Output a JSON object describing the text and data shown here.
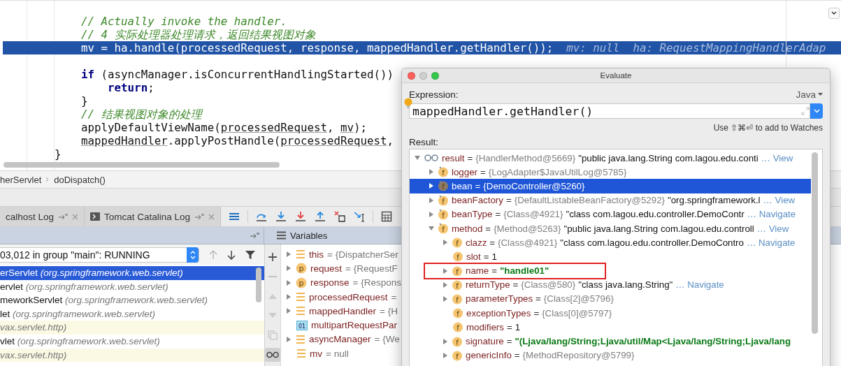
{
  "editor": {
    "lines": [
      {
        "kind": "body",
        "selected": false,
        "tokens": [
          {
            "text": "// Actually invoke the handler.",
            "kind": "comment"
          }
        ]
      },
      {
        "kind": "body",
        "selected": false,
        "tokens": [
          {
            "text": "// 4 实际处理器处理请求，返回结果视图对象",
            "kind": "comment"
          }
        ]
      },
      {
        "kind": "body",
        "selected": true,
        "tokens": [
          {
            "text": "mv = ha.handle(processedRequest, response, mappedHandler.getHandler());",
            "kind": "plain"
          }
        ],
        "hint": "mv: null  ha: RequestMappingHandlerAdap"
      },
      {
        "kind": "blank",
        "selected": false
      },
      {
        "kind": "body",
        "selected": false,
        "tokens": [
          {
            "text": "if",
            "kind": "keyword"
          },
          {
            "text": " (asyncManager.isConcurrentHandlingStarted())",
            "kind": "plain"
          }
        ]
      },
      {
        "kind": "inner",
        "selected": false,
        "tokens": [
          {
            "text": "return",
            "kind": "keyword"
          },
          {
            "text": ";",
            "kind": "plain"
          }
        ]
      },
      {
        "kind": "body",
        "selected": false,
        "tokens": [
          {
            "text": "}",
            "kind": "plain"
          }
        ]
      },
      {
        "kind": "body",
        "selected": false,
        "tokens": [
          {
            "text": "// 结果视图对象的处理",
            "kind": "comment"
          }
        ]
      },
      {
        "kind": "body",
        "selected": false,
        "tokens": [
          {
            "text": "applyDefaultViewName(",
            "kind": "plain"
          },
          {
            "text": "processedRequest",
            "kind": "underlined"
          },
          {
            "text": ", ",
            "kind": "plain"
          },
          {
            "text": "mv",
            "kind": "underlined"
          },
          {
            "text": ");",
            "kind": "plain"
          }
        ]
      },
      {
        "kind": "body",
        "selected": false,
        "tokens": [
          {
            "text": "mappedHandler",
            "kind": "underlined"
          },
          {
            "text": ".applyPostHandle(",
            "kind": "plain"
          },
          {
            "text": "processedRequest",
            "kind": "underlined"
          },
          {
            "text": ",",
            "kind": "plain"
          }
        ]
      },
      {
        "kind": "close",
        "selected": false,
        "tokens": [
          {
            "text": "}",
            "kind": "plain"
          }
        ]
      }
    ]
  },
  "breadcrumb": [
    "herServlet",
    "doDispatch()"
  ],
  "debug_tabs": [
    {
      "label": "calhost Log",
      "selected": false
    },
    {
      "label": "Tomcat Catalina Log",
      "selected": false
    }
  ],
  "frames": {
    "thread": "03,012 in group \"main\": RUNNING",
    "items": [
      {
        "method": "erServlet",
        "package": "(org.springframework.web.servlet)",
        "selected": true,
        "library": false
      },
      {
        "method": "ervlet",
        "package": "(org.springframework.web.servlet)",
        "selected": false,
        "library": false
      },
      {
        "method": "meworkServlet",
        "package": "(org.springframework.web.servlet)",
        "selected": false,
        "library": false
      },
      {
        "method": "let",
        "package": "(org.springframework.web.servlet)",
        "selected": false,
        "library": false
      },
      {
        "package": "vax.servlet.http)",
        "selected": false,
        "library": true
      },
      {
        "method": "vlet",
        "package": "(org.springframework.web.servlet)",
        "selected": false,
        "library": false
      },
      {
        "package": "vax.servlet.http)",
        "selected": false,
        "library": true
      }
    ]
  },
  "variables": {
    "title": "Variables",
    "items": [
      {
        "kind": "local",
        "name": "this",
        "value": "= {DispatcherSer",
        "expanded": false
      },
      {
        "kind": "param",
        "badge": "p",
        "name": "request",
        "value": "= {RequestF",
        "expanded": false
      },
      {
        "kind": "param",
        "badge": "p",
        "name": "response",
        "value": "= {Respons",
        "expanded": false
      },
      {
        "kind": "local",
        "name": "processedRequest",
        "value": "=",
        "expanded": false
      },
      {
        "kind": "local",
        "name": "mappedHandler",
        "value": "= {H",
        "expanded": false
      },
      {
        "kind": "primitive",
        "badge": "01",
        "name": "multipartRequestPar"
      },
      {
        "kind": "local",
        "name": "asyncManager",
        "value": "= {We",
        "expanded": false
      },
      {
        "kind": "local",
        "name": "mv",
        "value": "= null"
      }
    ]
  },
  "evaluate": {
    "title": "Evaluate",
    "expression_label": "Expression:",
    "language": "Java",
    "expression": "mappedHandler.getHandler()",
    "watch_hint": "Use ⇧⌘⏎ to add to Watches",
    "result_label": "Result:",
    "tree": [
      {
        "kind": "watch",
        "name": "result",
        "sep": "=",
        "ref": "{HandlerMethod@5669}",
        "value": "\"public java.lang.String com.lagou.edu.conti",
        "link": "… View",
        "expanded": true,
        "selected": false,
        "highlighted": false,
        "children": [
          {
            "kind": "final-field",
            "badge": "f",
            "name": "logger",
            "sep": "=",
            "ref": "{LogAdapter$JavaUtilLog@5785}",
            "expanded": false,
            "selected": false,
            "highlighted": false
          },
          {
            "kind": "final-field",
            "badge": "f",
            "name": "bean",
            "sep": "=",
            "ref": "{DemoController@5260}",
            "expanded": false,
            "selected": true,
            "highlighted": false
          },
          {
            "kind": "final-field",
            "badge": "f",
            "name": "beanFactory",
            "sep": "=",
            "ref": "{DefaultListableBeanFactory@5292}",
            "value": "\"org.springframework.l",
            "link": "… View",
            "expanded": false,
            "selected": false,
            "highlighted": false
          },
          {
            "kind": "final-field",
            "badge": "f",
            "name": "beanType",
            "sep": "=",
            "ref": "{Class@4921}",
            "value": "\"class com.lagou.edu.controller.DemoContr",
            "link": "… Navigate",
            "expanded": false,
            "selected": false,
            "highlighted": false
          },
          {
            "kind": "final-field",
            "badge": "f",
            "name": "method",
            "sep": "=",
            "ref": "{Method@5263}",
            "value": "\"public java.lang.String com.lagou.edu.controll",
            "link": "… View",
            "expanded": true,
            "selected": false,
            "highlighted": false,
            "children": [
              {
                "kind": "field",
                "badge": "f",
                "name": "clazz",
                "sep": "=",
                "ref": "{Class@4921}",
                "value": "\"class com.lagou.edu.controller.DemoContro",
                "link": "… Navigate",
                "expanded": false,
                "selected": false,
                "highlighted": false
              },
              {
                "kind": "field",
                "badge": "f",
                "name": "slot",
                "sep": "=",
                "value": "1",
                "selected": false,
                "highlighted": false
              },
              {
                "kind": "field",
                "badge": "f",
                "name": "name",
                "sep": "=",
                "string": "\"handle01\"",
                "expanded": false,
                "selected": false,
                "highlighted": true
              },
              {
                "kind": "field",
                "badge": "f",
                "name": "returnType",
                "sep": "=",
                "ref": "{Class@580}",
                "value": "\"class java.lang.String\"",
                "link": "… Navigate",
                "expanded": false,
                "selected": false,
                "highlighted": false
              },
              {
                "kind": "field",
                "badge": "f",
                "name": "parameterTypes",
                "sep": "=",
                "ref": "{Class[2]@5796}",
                "expanded": false,
                "selected": false,
                "highlighted": false
              },
              {
                "kind": "field",
                "badge": "f",
                "name": "exceptionTypes",
                "sep": "=",
                "ref": "{Class[0]@5797}",
                "selected": false,
                "highlighted": false
              },
              {
                "kind": "field",
                "badge": "f",
                "name": "modifiers",
                "sep": "=",
                "value": "1",
                "selected": false,
                "highlighted": false
              },
              {
                "kind": "field",
                "badge": "f",
                "name": "signature",
                "sep": "=",
                "string": "\"(Ljava/lang/String;Ljava/util/Map<Ljava/lang/String;Ljava/lang",
                "expanded": false,
                "selected": false,
                "highlighted": false
              },
              {
                "kind": "field",
                "badge": "f",
                "name": "genericInfo",
                "sep": "=",
                "ref": "{MethodRepository@5799}",
                "expanded": false,
                "selected": false,
                "highlighted": false
              }
            ]
          }
        ]
      }
    ]
  }
}
